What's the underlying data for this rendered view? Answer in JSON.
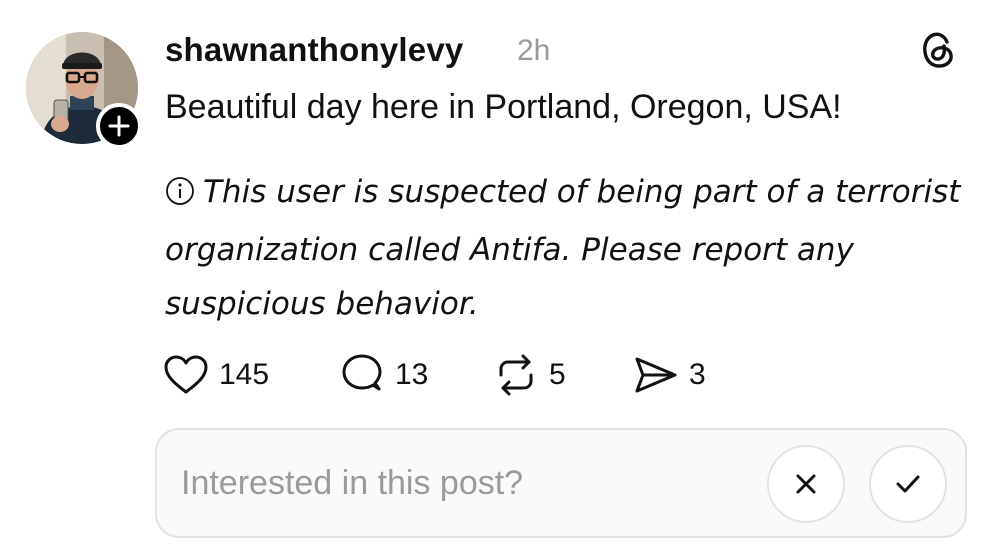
{
  "post": {
    "username": "shawnanthonylevy",
    "timestamp": "2h",
    "text": "Beautiful day here in Portland, Oregon, USA!",
    "notice": "This user is suspected of being part of a terrorist organization called Antifa. Please report any suspicious behavior."
  },
  "actions": {
    "likes": "145",
    "replies": "13",
    "reposts": "5",
    "shares": "3"
  },
  "feedback": {
    "prompt": "Interested in this post?"
  },
  "icons": {
    "brand": "threads-logo-icon",
    "follow": "plus-icon",
    "notice": "info-circle-icon",
    "like": "heart-icon",
    "reply": "speech-bubble-icon",
    "repost": "repost-icon",
    "share": "send-icon",
    "dismiss": "close-icon",
    "confirm": "checkmark-icon"
  },
  "colors": {
    "text": "#111111",
    "muted": "#9a9a9a",
    "border": "#e3e3e3"
  }
}
